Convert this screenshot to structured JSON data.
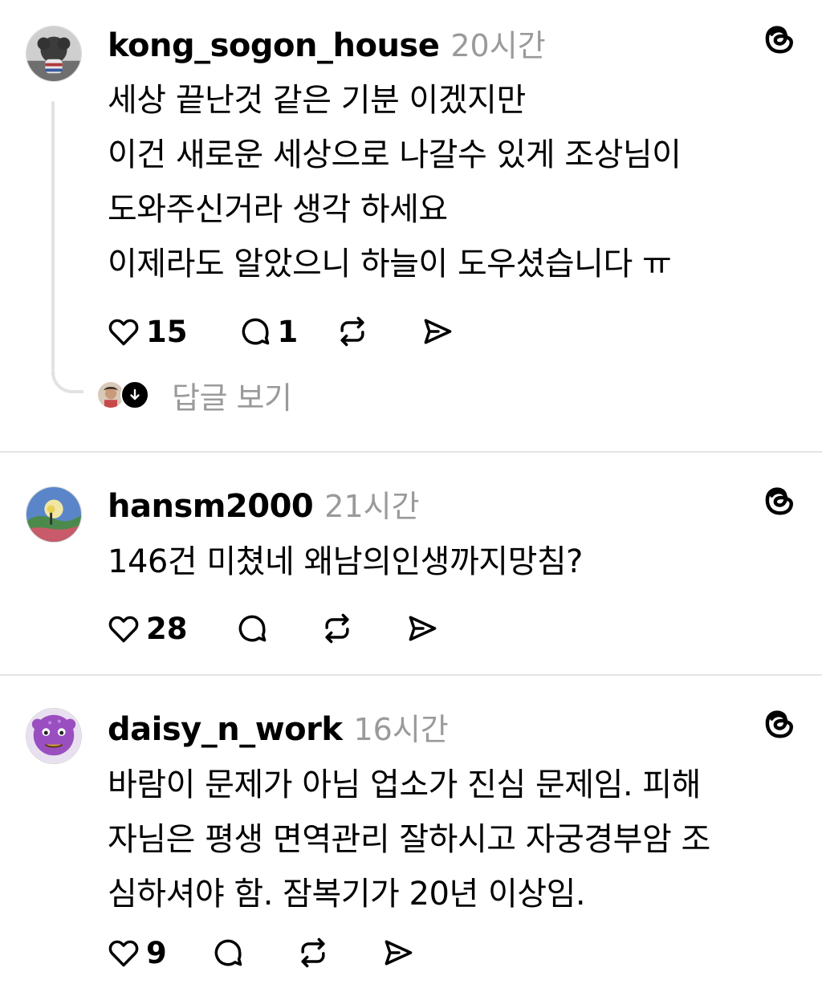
{
  "posts": [
    {
      "username": "kong_sogon_house",
      "time": "20시간",
      "lines": [
        "세상 끝난것 같은 기분 이겠지만",
        "이건 새로운 세상으로 나갈수 있게 조상님이",
        "도와주신거라 생각 하세요",
        "이제라도 알았으니 하늘이 도우셨습니다 ㅠ"
      ],
      "likes": "15",
      "replies": "1",
      "view_replies_label": "답글 보기"
    },
    {
      "username": "hansm2000",
      "time": "21시간",
      "lines": [
        "146건 미쳤네 왜남의인생까지망침?"
      ],
      "likes": "28",
      "replies": ""
    },
    {
      "username": "daisy_n_work",
      "time": "16시간",
      "lines": [
        "바람이 문제가 아님 업소가 진심 문제임. 피해",
        "자님은 평생 면역관리 잘하시고 자궁경부암 조",
        "심하셔야 함.  잠복기가 20년 이상임."
      ],
      "likes": "9",
      "replies": ""
    }
  ],
  "icons": {
    "like": "heart-icon",
    "reply": "speech-bubble-icon",
    "repost": "repost-icon",
    "share": "send-icon",
    "brand": "threads-logo-icon",
    "expand": "arrow-down-icon"
  },
  "colors": {
    "text": "#000000",
    "muted": "#9a9a9a",
    "divider": "#e4e4e4",
    "thread_line": "#e2e2e2"
  }
}
